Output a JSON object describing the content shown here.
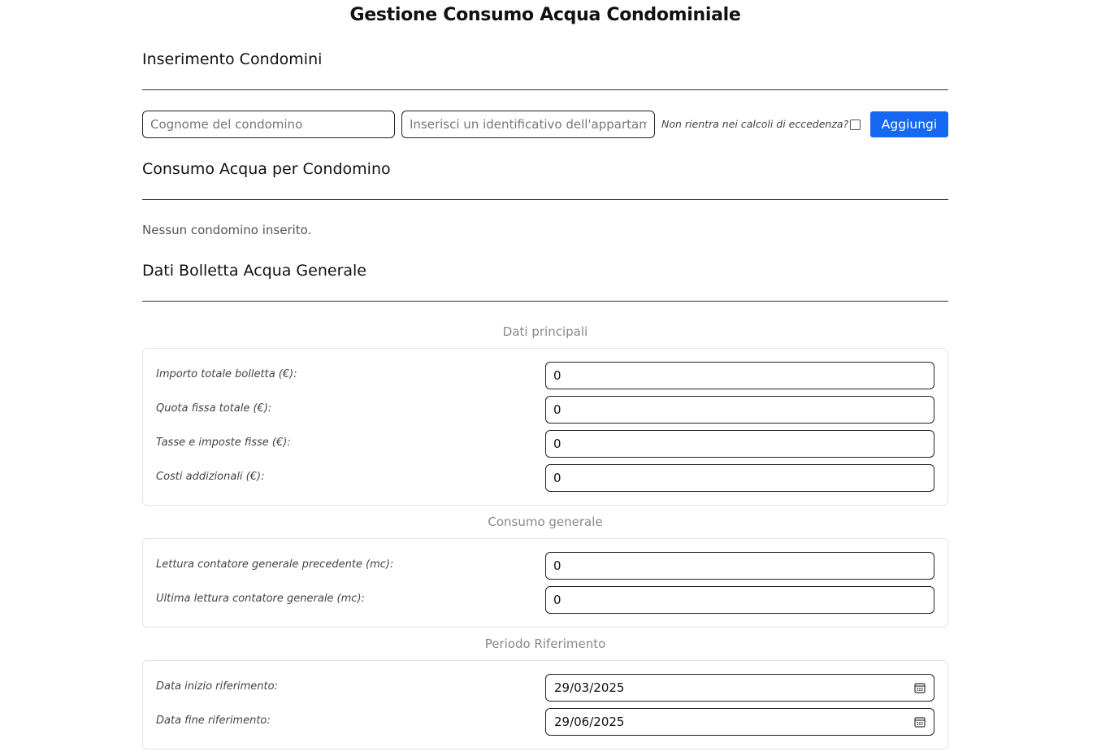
{
  "header": {
    "title": "Gestione Consumo Acqua Condominiale"
  },
  "insert_section": {
    "title": "Inserimento Condomini",
    "surname_placeholder": "Cognome del condomino",
    "apartment_placeholder": "Inserisci un identificativo dell'appartamento",
    "exclusion_label": "Non rientra nei calcoli di eccedenza?",
    "exclusion_checked": false,
    "add_label": "Aggiungi"
  },
  "consumption_section": {
    "title": "Consumo Acqua per Condomino",
    "empty_message": "Nessun condomino inserito."
  },
  "bill_section": {
    "title": "Dati Bolletta Acqua Generale",
    "groups": [
      {
        "caption": "Dati principali",
        "fields": [
          {
            "label": "Importo totale bolletta (€):",
            "value": "0"
          },
          {
            "label": "Quota fissa totale (€):",
            "value": "0"
          },
          {
            "label": "Tasse e imposte fisse (€):",
            "value": "0"
          },
          {
            "label": "Costi addizionali (€):",
            "value": "0"
          }
        ]
      },
      {
        "caption": "Consumo generale",
        "fields": [
          {
            "label": "Lettura contatore generale precedente (mc):",
            "value": "0"
          },
          {
            "label": "Ultima lettura contatore generale (mc):",
            "value": "0"
          }
        ]
      },
      {
        "caption": "Periodo Riferimento",
        "fields": [
          {
            "label": "Data inizio riferimento:",
            "value": "29/03/2025",
            "icon": "calendar-icon"
          },
          {
            "label": "Data fine riferimento:",
            "value": "29/06/2025",
            "icon": "calendar-icon"
          }
        ]
      }
    ]
  },
  "colors": {
    "accent": "#1668f2",
    "caption": "#888888",
    "panel_border": "#e3e3e3"
  }
}
